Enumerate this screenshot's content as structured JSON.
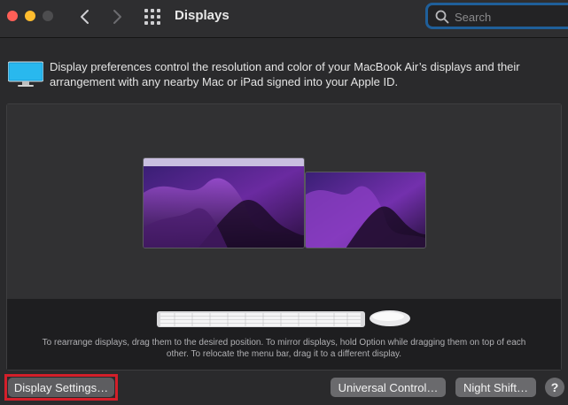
{
  "window": {
    "title": "Displays"
  },
  "search": {
    "placeholder": "Search",
    "value": ""
  },
  "description": "Display preferences control the resolution and color of your MacBook Air’s displays and their arrangement with any nearby Mac or iPad signed into your Apple ID.",
  "arrangement": {
    "hint": "To rearrange displays, drag them to the desired position. To mirror displays, hold Option while dragging them on top of each other. To relocate the menu bar, drag it to a different display."
  },
  "buttons": {
    "display_settings": "Display Settings…",
    "universal_control": "Universal Control…",
    "night_shift": "Night Shift…",
    "help": "?"
  },
  "icons": {
    "back": "chevron-left-icon",
    "forward": "chevron-right-icon",
    "show_all": "grid-icon",
    "search": "magnifying-glass-icon",
    "display": "display-icon"
  },
  "colors": {
    "highlight": "#d31f2a",
    "search_focus": "#1f5f9a",
    "close": "#ff5f57",
    "minimize": "#febc2e"
  }
}
